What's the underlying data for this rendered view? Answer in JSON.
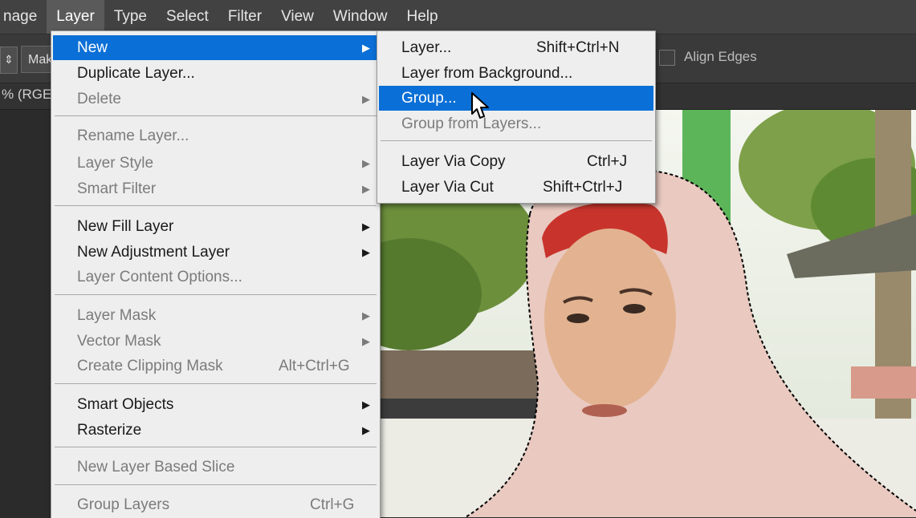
{
  "menubar": {
    "items": [
      {
        "label": "nage"
      },
      {
        "label": "Layer"
      },
      {
        "label": "Type"
      },
      {
        "label": "Select"
      },
      {
        "label": "Filter"
      },
      {
        "label": "View"
      },
      {
        "label": "Window"
      },
      {
        "label": "Help"
      }
    ]
  },
  "options": {
    "make_label": "Mak",
    "align_edges": "Align Edges"
  },
  "doc_tab": {
    "label": "% (RGE"
  },
  "layer_menu": {
    "new": "New",
    "duplicate": "Duplicate Layer...",
    "delete": "Delete",
    "rename": "Rename Layer...",
    "layer_style": "Layer Style",
    "smart_filter": "Smart Filter",
    "new_fill": "New Fill Layer",
    "new_adjustment": "New Adjustment Layer",
    "content_options": "Layer Content Options...",
    "layer_mask": "Layer Mask",
    "vector_mask": "Vector Mask",
    "clipping_mask": "Create Clipping Mask",
    "clipping_mask_shortcut": "Alt+Ctrl+G",
    "smart_objects": "Smart Objects",
    "rasterize": "Rasterize",
    "new_slice": "New Layer Based Slice",
    "group_layers": "Group Layers",
    "group_layers_shortcut": "Ctrl+G"
  },
  "new_submenu": {
    "layer": "Layer...",
    "layer_shortcut": "Shift+Ctrl+N",
    "from_background": "Layer from Background...",
    "group": "Group...",
    "group_from_layers": "Group from Layers...",
    "via_copy": "Layer Via Copy",
    "via_copy_shortcut": "Ctrl+J",
    "via_cut": "Layer Via Cut",
    "via_cut_shortcut": "Shift+Ctrl+J"
  },
  "icons": {
    "submenu_arrow": "submenu-arrow-icon",
    "cursor": "pointer-cursor-icon"
  },
  "colors": {
    "highlight": "#0a6fd6",
    "menu_bg": "#eeeeee",
    "menubar_bg": "#424242"
  }
}
